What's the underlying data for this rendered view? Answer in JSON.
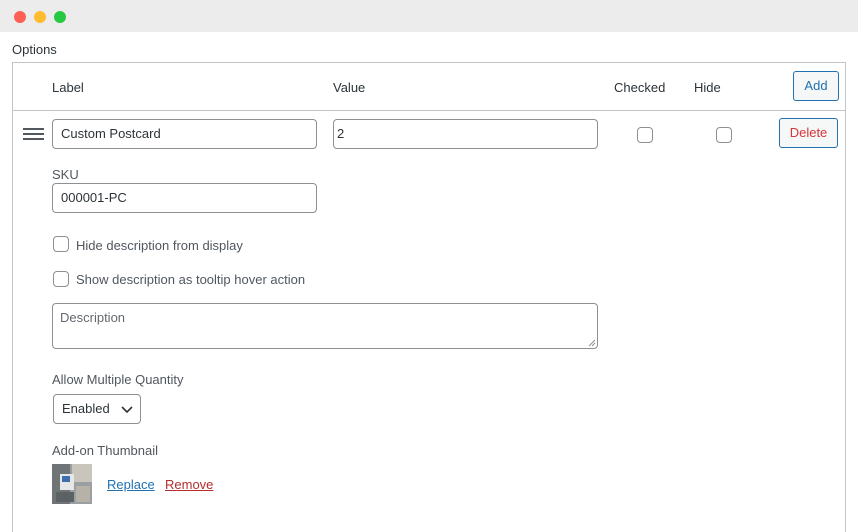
{
  "window": {
    "controls": [
      "close",
      "minimize",
      "zoom"
    ]
  },
  "section_title": "Options",
  "table_header": {
    "label": "Label",
    "value": "Value",
    "checked": "Checked",
    "hide": "Hide",
    "add_button": "Add"
  },
  "row": {
    "label_value": "Custom Postcard",
    "value_value": "2",
    "checked": false,
    "hide": false,
    "delete_button": "Delete",
    "sku_label": "SKU",
    "sku_value": "000001-PC",
    "hide_description_label": "Hide description from display",
    "hide_description_checked": false,
    "tooltip_label": "Show description as tooltip hover action",
    "tooltip_checked": false,
    "description_placeholder": "Description",
    "quantity_label": "Allow Multiple Quantity",
    "quantity_selected": "Enabled",
    "thumbnail_label": "Add-on Thumbnail",
    "replace_link": "Replace",
    "remove_link": "Remove"
  },
  "colors": {
    "accent": "#2271b1",
    "danger": "#d63638",
    "border": "#c3c4c7",
    "titlebar": "#ececec"
  },
  "icons": [
    "close-dot-icon",
    "minimize-dot-icon",
    "zoom-dot-icon",
    "drag-handle-icon",
    "chevron-down-icon",
    "resize-grip-icon"
  ]
}
